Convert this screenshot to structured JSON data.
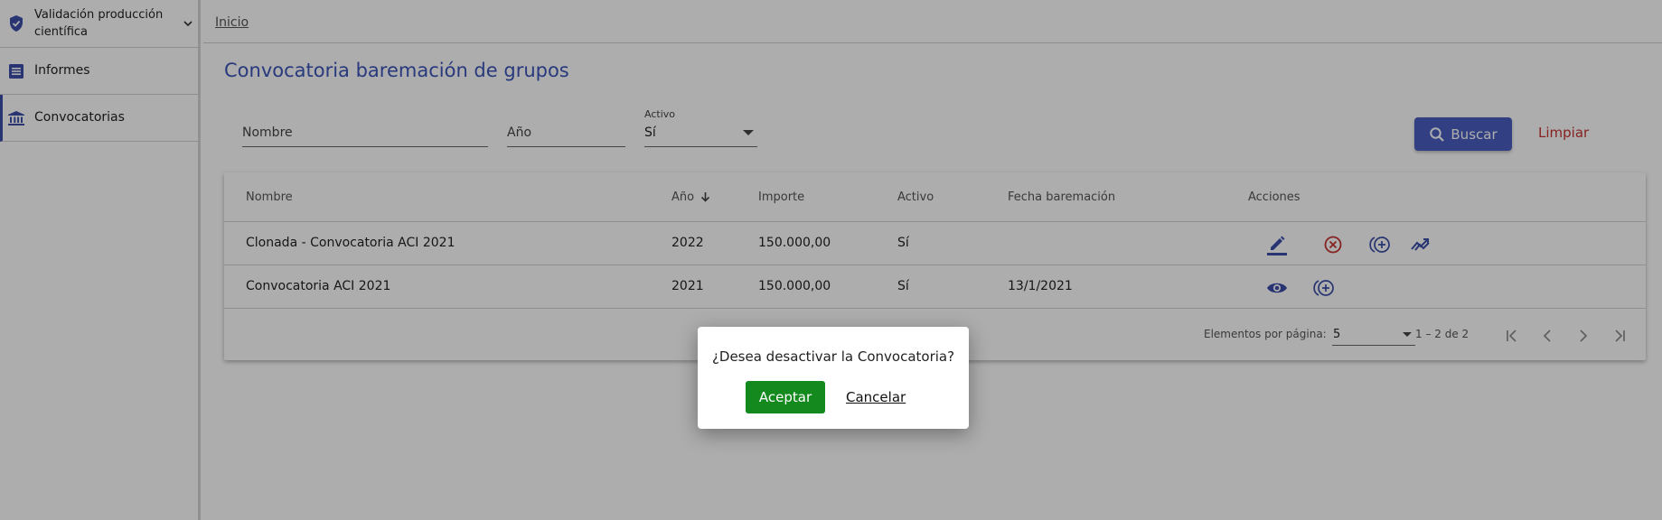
{
  "sidebar": {
    "items": [
      {
        "label": "Validación producción científica",
        "icon": "shield-check-icon"
      },
      {
        "label": "Informes",
        "icon": "list-icon"
      },
      {
        "label": "Convocatorias",
        "icon": "bank-icon"
      }
    ]
  },
  "breadcrumb": "Inicio",
  "page_title": "Convocatoria baremación de grupos",
  "filters": {
    "nombre_placeholder": "Nombre",
    "anio_placeholder": "Año",
    "activo_label": "Activo",
    "activo_value": "Sí"
  },
  "buttons": {
    "buscar": "Buscar",
    "limpiar": "Limpiar"
  },
  "table": {
    "headers": [
      "Nombre",
      "Año",
      "Importe",
      "Activo",
      "Fecha baremación",
      "Acciones"
    ],
    "rows": [
      {
        "nombre": "Clonada - Convocatoria ACI 2021",
        "anio": "2022",
        "importe": "150.000,00",
        "activo": "Sí",
        "fecha": ""
      },
      {
        "nombre": "Convocatoria ACI 2021",
        "anio": "2021",
        "importe": "150.000,00",
        "activo": "Sí",
        "fecha": "13/1/2021"
      }
    ]
  },
  "paginator": {
    "items_label": "Elementos por página:",
    "page_size": "5",
    "range": "1 – 2 de 2"
  },
  "dialog": {
    "message": "¿Desea desactivar la Convocatoria?",
    "accept": "Aceptar",
    "cancel": "Cancelar"
  },
  "colors": {
    "primary": "#3b54b8",
    "danger": "#c63333",
    "success": "#148a1e"
  }
}
